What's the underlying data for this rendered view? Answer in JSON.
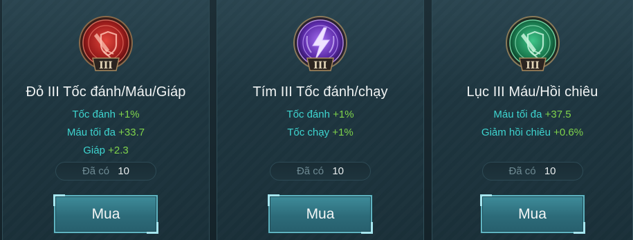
{
  "cards": [
    {
      "title": "Đỏ III Tốc đánh/Máu/Giáp",
      "tier": "III",
      "stats": [
        {
          "name": "Tốc đánh",
          "value": "+1%"
        },
        {
          "name": "Máu tối đa",
          "value": "+33.7"
        },
        {
          "name": "Giáp",
          "value": "+2.3"
        }
      ],
      "owned_label": "Đã có",
      "owned_count": "10",
      "buy_label": "Mua",
      "emblem_color": "#c2302c",
      "emblem_icon": "red-sword-shield-icon"
    },
    {
      "title": "Tím III Tốc đánh/chạy",
      "tier": "III",
      "stats": [
        {
          "name": "Tốc đánh",
          "value": "+1%"
        },
        {
          "name": "Tốc chạy",
          "value": "+1%"
        }
      ],
      "owned_label": "Đã có",
      "owned_count": "10",
      "buy_label": "Mua",
      "emblem_color": "#7a3ec8",
      "emblem_icon": "purple-lightning-icon"
    },
    {
      "title": "Lục III Máu/Hồi chiêu",
      "tier": "III",
      "stats": [
        {
          "name": "Máu tối đa",
          "value": "+37.5"
        },
        {
          "name": "Giảm hồi chiêu",
          "value": "+0.6%"
        }
      ],
      "owned_label": "Đã có",
      "owned_count": "10",
      "buy_label": "Mua",
      "emblem_color": "#1f8a5a",
      "emblem_icon": "green-sword-shield-icon"
    }
  ]
}
